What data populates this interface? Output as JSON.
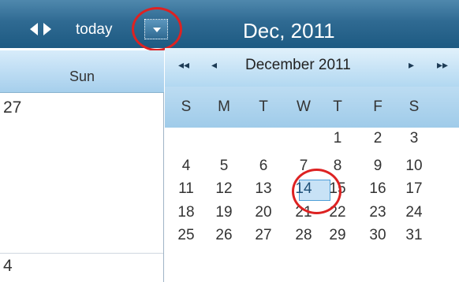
{
  "toolbar": {
    "today_label": "today",
    "title": "Dec, 2011",
    "prev_icon": "caret-left-icon",
    "next_icon": "caret-right-icon",
    "dropdown_icon": "caret-down-icon"
  },
  "day_view": {
    "header": "Sun",
    "dates": [
      "27",
      "4"
    ]
  },
  "mini_calendar": {
    "month_label": "December 2011",
    "nav": {
      "prev_year": "◂◂",
      "prev_month": "◂",
      "next_month": "▸",
      "next_year": "▸▸"
    },
    "weekdays": [
      "S",
      "M",
      "T",
      "W",
      "T",
      "F",
      "S"
    ],
    "weeks": [
      [
        "",
        "",
        "",
        "",
        "1",
        "2",
        "3"
      ],
      [
        "4",
        "5",
        "6",
        "7",
        "8",
        "9",
        "10"
      ],
      [
        "11",
        "12",
        "13",
        "14",
        "15",
        "16",
        "17"
      ],
      [
        "18",
        "19",
        "20",
        "21",
        "22",
        "23",
        "24"
      ],
      [
        "25",
        "26",
        "27",
        "28",
        "29",
        "30",
        "31"
      ]
    ],
    "selected_day": "14"
  },
  "colors": {
    "toolbar": "#2f6a92",
    "highlight": "#c8e2f6",
    "annotation": "#dd2222"
  }
}
